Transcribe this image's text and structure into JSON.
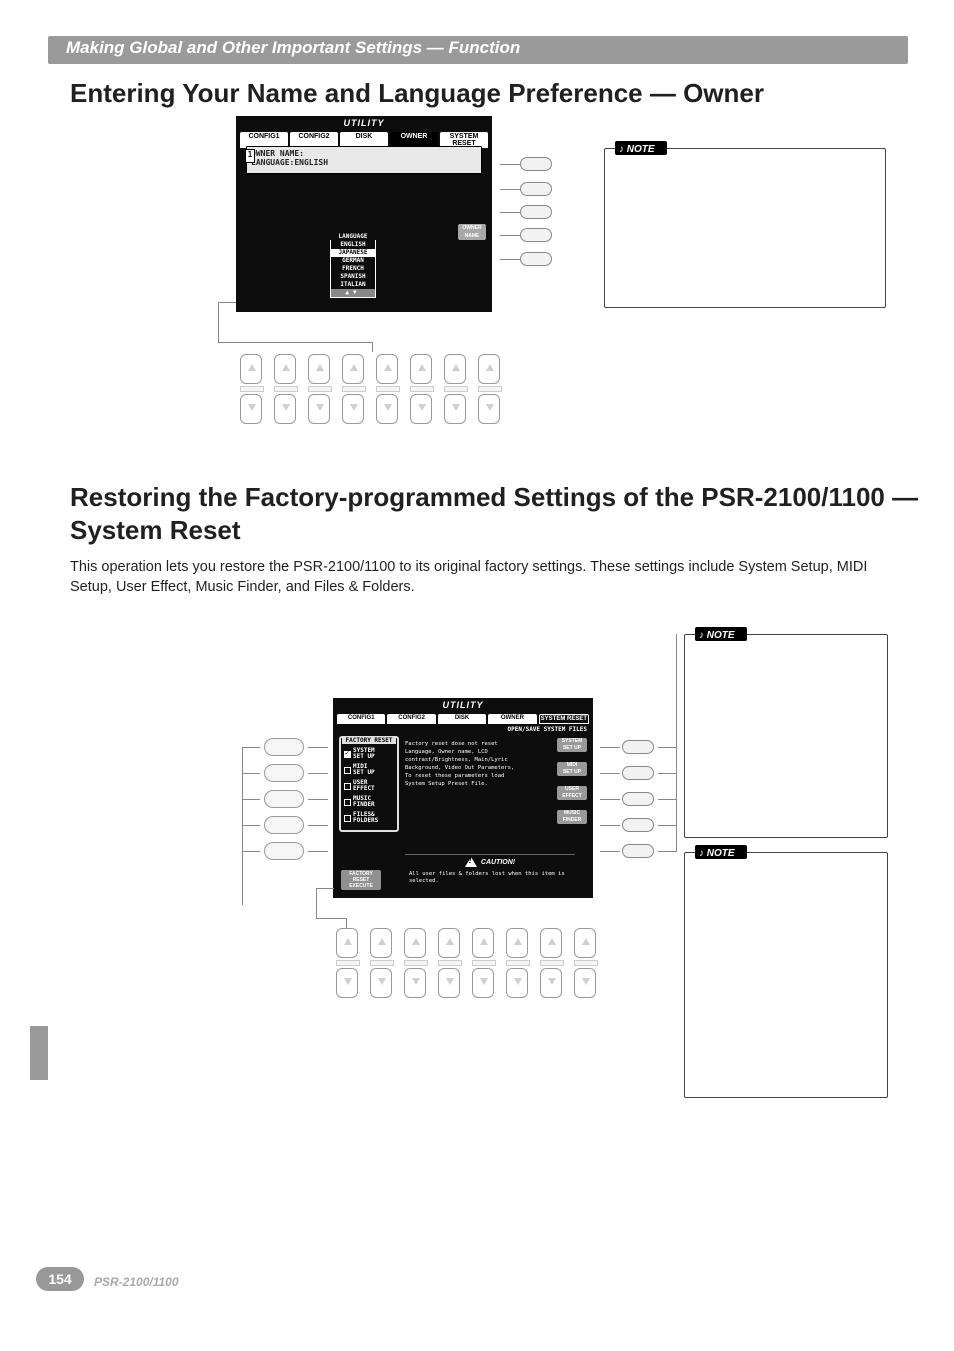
{
  "header": {
    "breadcrumb": "Making Global and Other Important Settings — Function"
  },
  "section1": {
    "title": "Entering Your Name and Language Preference — Owner",
    "lcd": {
      "title": "UTILITY",
      "tabs": [
        "CONFIG1",
        "CONFIG2",
        "DISK",
        "OWNER",
        "SYSTEM RESET"
      ],
      "selected_tab_index": 3,
      "box_number": "1",
      "owner_name_label": "OWNER NAME:",
      "language_line": "LANGUAGE:ENGLISH",
      "right_button": "OWNER\nNAME",
      "language_panel_title": "LANGUAGE",
      "languages": [
        "ENGLISH",
        "JAPANESE",
        "GERMAN",
        "FRENCH",
        "SPANISH",
        "ITALIAN"
      ],
      "highlighted_language_index": 1
    },
    "note_label": "NOTE"
  },
  "section2": {
    "title": "Restoring the Factory-programmed Settings of the PSR-2100/1100 — System Reset",
    "paragraph": "This operation lets you restore the PSR-2100/1100 to its original factory settings. These settings include System Setup, MIDI Setup, User Effect, Music Finder, and Files & Folders.",
    "lcd": {
      "title": "UTILITY",
      "tabs": [
        "CONFIG1",
        "CONFIG2",
        "DISK",
        "OWNER",
        "SYSTEM RESET"
      ],
      "selected_tab_index": 4,
      "subheader": "OPEN/SAVE SYSTEM FILES",
      "factory_reset_header": "FACTORY RESET",
      "left_items": [
        {
          "label": "SYSTEM\nSET UP",
          "checked": true
        },
        {
          "label": "MIDI\nSET UP",
          "checked": false
        },
        {
          "label": "USER\nEFFECT",
          "checked": false
        },
        {
          "label": "MUSIC\nFINDER",
          "checked": false
        },
        {
          "label": "FILES&\nFOLDERS",
          "checked": false
        }
      ],
      "right_items": [
        "SYSTEM\nSET UP",
        "MIDI\nSET UP",
        "USER\nEFFECT",
        "MUSIC\nFINDER"
      ],
      "description": "Factory reset dose not reset Language, Owner name, LCD contrast/Brightness, Main/Lyric Background, Video Out Parameters, To reset these parameters load System Setup Preset File.",
      "execute_label": "FACTORY\nRESET\nEXECUTE",
      "caution_label": "CAUTION!",
      "caution_text": "All user files & folders lost when this item is selected."
    },
    "note_label": "NOTE"
  },
  "footer": {
    "page": "154",
    "model": "PSR-2100/1100"
  }
}
